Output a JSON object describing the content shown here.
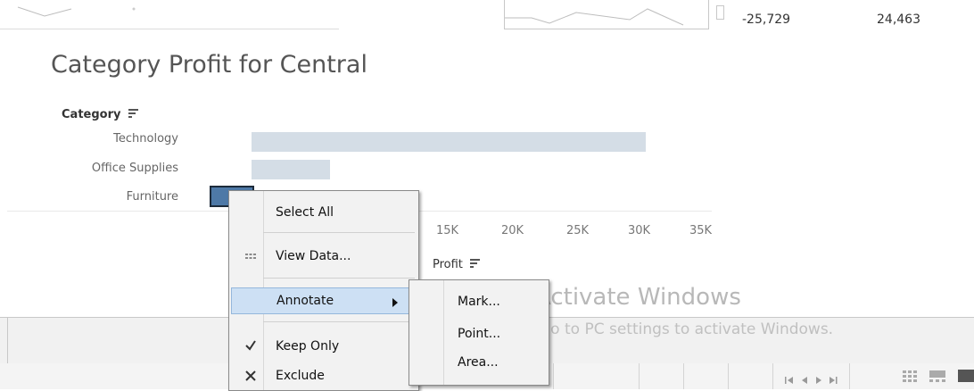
{
  "top_row": {
    "value_1": "-25,729",
    "value_2": "24,463"
  },
  "title": "Category Profit for Central",
  "chart_data": {
    "type": "bar",
    "orientation": "horizontal",
    "category_header": "Category",
    "categories": [
      "Technology",
      "Office Supplies",
      "Furniture"
    ],
    "values": [
      33700,
      9300,
      2900
    ],
    "selected_category": "Furniture",
    "xlabel": "Profit",
    "x_ticks": [
      "15K",
      "20K",
      "25K",
      "30K",
      "35K"
    ],
    "xlim": [
      0,
      35000
    ],
    "colors": {
      "bar": "#d4dde6",
      "selected": "#4e79a7"
    }
  },
  "context_menu": {
    "items": [
      {
        "label": "Select All",
        "icon": ""
      },
      {
        "label": "View Data...",
        "icon": "grid-icon"
      },
      {
        "label": "Annotate",
        "icon": "",
        "has_submenu": true,
        "highlighted": true
      },
      {
        "label": "Keep Only",
        "icon": "check-icon"
      },
      {
        "label": "Exclude",
        "icon": "x-icon"
      }
    ],
    "submenu": {
      "items": [
        "Mark...",
        "Point...",
        "Area..."
      ]
    }
  },
  "watermark": {
    "title": "Activate Windows",
    "subtitle": "Go to PC settings to activate Windows."
  },
  "icons": [
    "sort-icon",
    "grid-icon",
    "check-icon",
    "x-icon",
    "submenu-arrow-icon",
    "first-page-icon",
    "prev-page-icon",
    "next-page-icon",
    "last-page-icon",
    "grid-view-icon",
    "filmstrip-icon"
  ]
}
